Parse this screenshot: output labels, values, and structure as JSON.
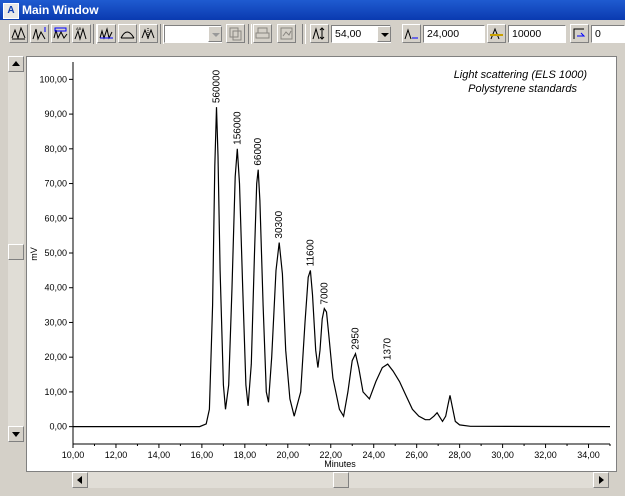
{
  "window": {
    "title": "Main Window"
  },
  "toolbar": {
    "dropdown_empty_value": "",
    "slider_value": "54,00",
    "field_a_value": "24,000",
    "field_b_value": "10000",
    "field_c_value": "0"
  },
  "chart_data": {
    "type": "line",
    "title": "Light scattering (ELS 1000)",
    "subtitle": "Polystyrene standards",
    "xlabel": "Minutes",
    "ylabel": "mV",
    "xlim": [
      10,
      35
    ],
    "ylim": [
      -5,
      105
    ],
    "x_ticks": [
      "10,00",
      "12,00",
      "14,00",
      "16,00",
      "18,00",
      "20,00",
      "22,00",
      "24,00",
      "26,00",
      "28,00",
      "30,00",
      "32,00",
      "34,00"
    ],
    "y_ticks": [
      "0,00",
      "10,00",
      "20,00",
      "30,00",
      "40,00",
      "50,00",
      "60,00",
      "70,00",
      "80,00",
      "90,00",
      "100,00"
    ],
    "grid": false,
    "series": [
      {
        "values": [
          [
            10.0,
            0.0
          ],
          [
            15.9,
            0.0
          ],
          [
            16.2,
            0.8
          ],
          [
            16.35,
            5
          ],
          [
            16.5,
            35
          ],
          [
            16.6,
            75
          ],
          [
            16.68,
            92
          ],
          [
            16.75,
            78
          ],
          [
            16.85,
            45
          ],
          [
            17.0,
            12
          ],
          [
            17.1,
            5
          ],
          [
            17.25,
            12
          ],
          [
            17.4,
            40
          ],
          [
            17.55,
            72
          ],
          [
            17.65,
            80
          ],
          [
            17.75,
            70
          ],
          [
            17.9,
            40
          ],
          [
            18.05,
            12
          ],
          [
            18.15,
            6
          ],
          [
            18.3,
            18
          ],
          [
            18.45,
            50
          ],
          [
            18.55,
            70
          ],
          [
            18.62,
            74
          ],
          [
            18.7,
            65
          ],
          [
            18.85,
            35
          ],
          [
            19.0,
            10
          ],
          [
            19.1,
            7
          ],
          [
            19.25,
            20
          ],
          [
            19.45,
            45
          ],
          [
            19.6,
            53
          ],
          [
            19.75,
            44
          ],
          [
            19.9,
            22
          ],
          [
            20.1,
            8
          ],
          [
            20.3,
            3
          ],
          [
            20.6,
            10
          ],
          [
            20.8,
            30
          ],
          [
            20.95,
            43
          ],
          [
            21.05,
            45
          ],
          [
            21.15,
            38
          ],
          [
            21.3,
            22
          ],
          [
            21.4,
            17
          ],
          [
            21.5,
            22
          ],
          [
            21.6,
            31
          ],
          [
            21.7,
            34
          ],
          [
            21.8,
            33
          ],
          [
            21.9,
            27
          ],
          [
            22.1,
            14
          ],
          [
            22.4,
            5
          ],
          [
            22.6,
            3
          ],
          [
            22.8,
            10
          ],
          [
            23.0,
            19
          ],
          [
            23.15,
            21
          ],
          [
            23.3,
            17
          ],
          [
            23.5,
            10
          ],
          [
            23.8,
            8
          ],
          [
            24.1,
            13
          ],
          [
            24.4,
            17
          ],
          [
            24.65,
            18
          ],
          [
            24.9,
            16
          ],
          [
            25.2,
            13
          ],
          [
            25.5,
            9
          ],
          [
            25.8,
            5
          ],
          [
            26.1,
            3
          ],
          [
            26.4,
            2
          ],
          [
            26.6,
            2
          ],
          [
            26.8,
            3
          ],
          [
            26.95,
            4
          ],
          [
            27.05,
            3
          ],
          [
            27.2,
            1.5
          ],
          [
            27.35,
            3
          ],
          [
            27.45,
            6
          ],
          [
            27.55,
            9
          ],
          [
            27.65,
            6
          ],
          [
            27.8,
            1.5
          ],
          [
            28.0,
            0.5
          ],
          [
            28.5,
            0.1
          ],
          [
            35.0,
            0.0
          ]
        ]
      }
    ],
    "annotations": [
      {
        "text": "560000",
        "x": 16.68,
        "y": 92
      },
      {
        "text": "156000",
        "x": 17.65,
        "y": 80
      },
      {
        "text": "66000",
        "x": 18.62,
        "y": 74
      },
      {
        "text": "30300",
        "x": 19.6,
        "y": 53
      },
      {
        "text": "11600",
        "x": 21.05,
        "y": 45
      },
      {
        "text": "7000",
        "x": 21.7,
        "y": 34
      },
      {
        "text": "2950",
        "x": 23.15,
        "y": 21
      },
      {
        "text": "1370",
        "x": 24.65,
        "y": 18
      }
    ],
    "colors": {
      "line": "#000000"
    }
  }
}
